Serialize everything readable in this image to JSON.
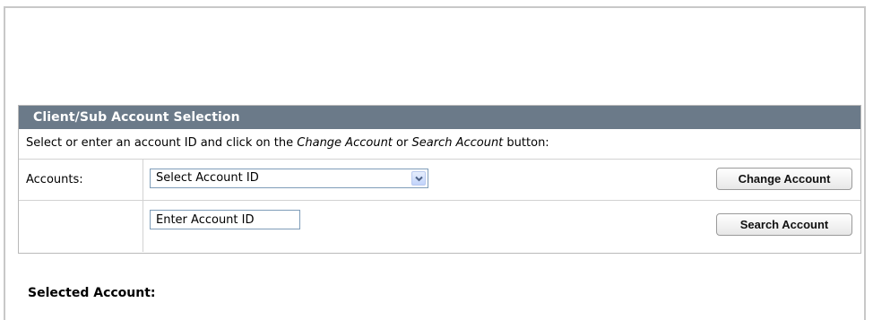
{
  "panel": {
    "title": "Client/Sub Account Selection",
    "instructions": {
      "prefix": "Select or enter an account ID and click on the ",
      "change_ref": "Change Account",
      "middle": " or ",
      "search_ref": "Search Account",
      "suffix": " button:"
    },
    "accounts_row": {
      "label": "Accounts:",
      "select_value": "Select Account ID",
      "select_icon": "chevron-down-icon",
      "button_label": "Change Account"
    },
    "search_row": {
      "input_value": "",
      "input_placeholder": "Enter Account ID",
      "button_label": "Search Account"
    }
  },
  "selected": {
    "title": "Selected Account:"
  },
  "colors": {
    "header_bg": "#6b7a89",
    "header_text": "#ffffff",
    "border": "#d2d2d2",
    "input_border": "#7f9db9"
  }
}
